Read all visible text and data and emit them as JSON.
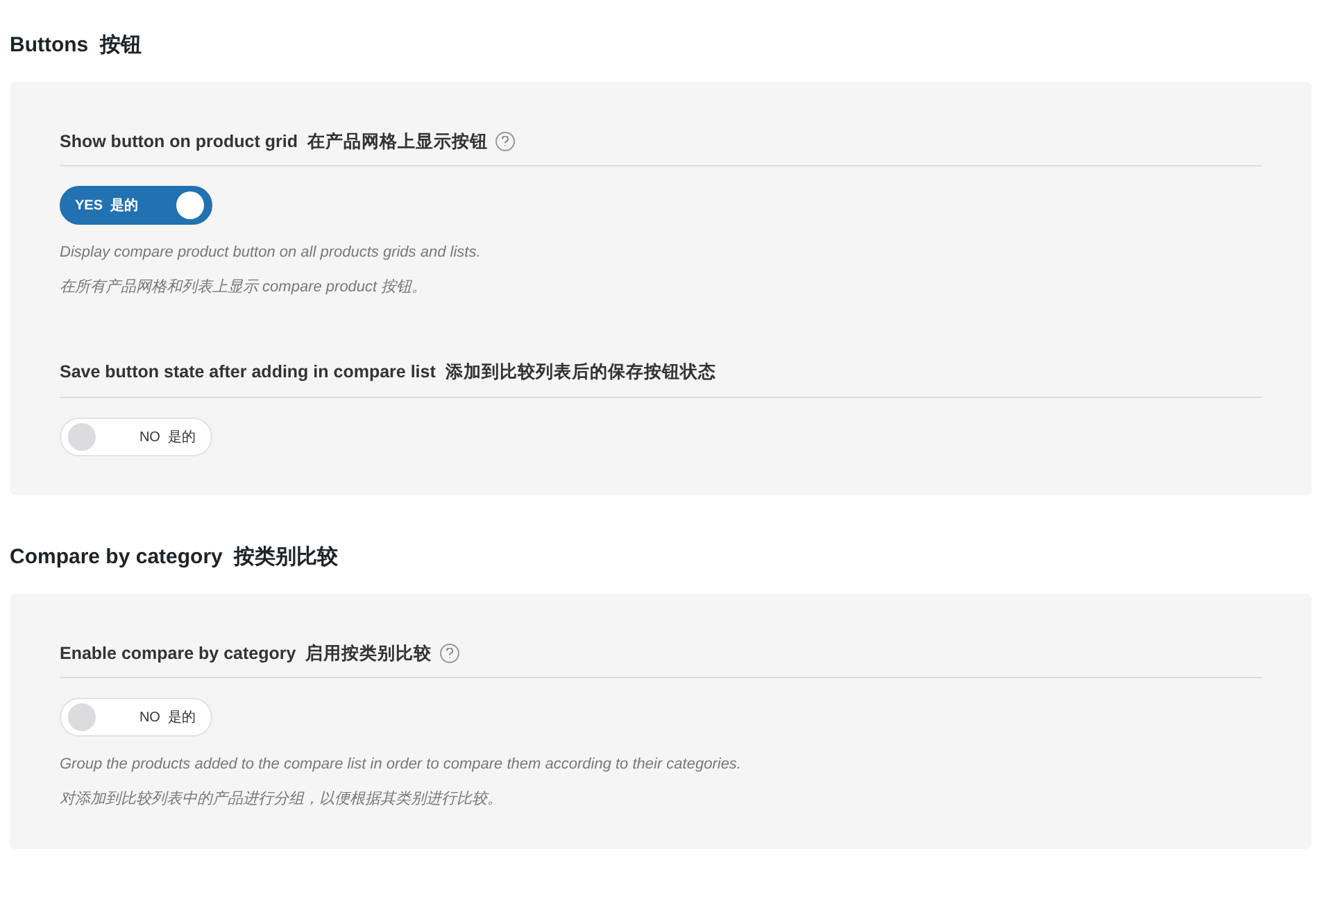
{
  "sections": [
    {
      "title": "Buttons  按钮",
      "fields": [
        {
          "label": "Show button on product grid  在产品网格上显示按钮",
          "help": true,
          "toggle": {
            "on": true,
            "label": "YES  是的"
          },
          "descriptions": [
            "Display compare product button on all products grids and lists.",
            "在所有产品网格和列表上显示 compare product 按钮。"
          ]
        },
        {
          "label": "Save button state after adding in compare list  添加到比较列表后的保存按钮状态",
          "help": false,
          "toggle": {
            "on": false,
            "label": "NO  是的"
          }
        }
      ]
    },
    {
      "title": "Compare by category  按类别比较",
      "fields": [
        {
          "label": "Enable compare by category  启用按类别比较",
          "help": true,
          "toggle": {
            "on": false,
            "label": "NO  是的"
          },
          "descriptions": [
            "Group the products added to the compare list in order to compare them according to their categories.",
            "对添加到比较列表中的产品进行分组，以便根据其类别进行比较。"
          ]
        }
      ]
    }
  ]
}
